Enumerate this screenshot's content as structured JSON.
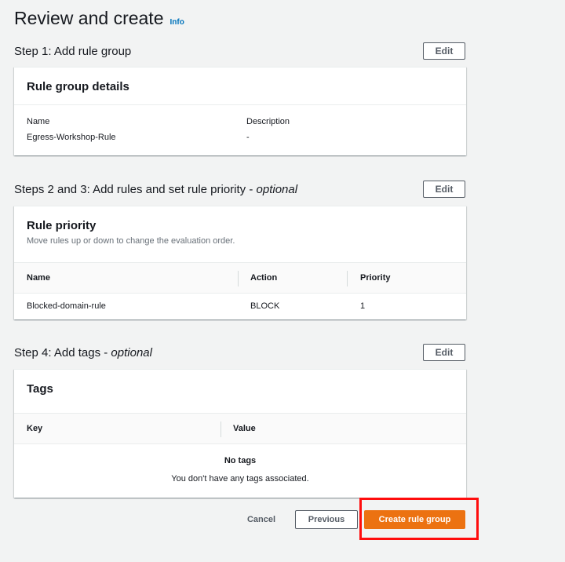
{
  "header": {
    "title": "Review and create",
    "info_label": "Info"
  },
  "step1": {
    "title": "Step 1: Add rule group",
    "edit_label": "Edit",
    "card": {
      "title": "Rule group details",
      "name_label": "Name",
      "name_value": "Egress-Workshop-Rule",
      "description_label": "Description",
      "description_value": "-"
    }
  },
  "step2": {
    "title_main": "Steps 2 and 3: Add rules and set rule priority - ",
    "title_optional": "optional",
    "edit_label": "Edit",
    "card": {
      "title": "Rule priority",
      "subtitle": "Move rules up or down to change the evaluation order.",
      "columns": [
        "Name",
        "Action",
        "Priority"
      ],
      "rows": [
        {
          "name": "Blocked-domain-rule",
          "action": "BLOCK",
          "priority": "1"
        }
      ]
    }
  },
  "step4": {
    "title_main": "Step 4: Add tags - ",
    "title_optional": "optional",
    "edit_label": "Edit",
    "card": {
      "title": "Tags",
      "columns": [
        "Key",
        "Value"
      ],
      "empty_title": "No tags",
      "empty_desc": "You don't have any tags associated."
    }
  },
  "footer": {
    "cancel_label": "Cancel",
    "previous_label": "Previous",
    "create_label": "Create rule group"
  },
  "colors": {
    "primary": "#ec7211",
    "link": "#0073bb",
    "highlight": "#ff0d0d"
  }
}
